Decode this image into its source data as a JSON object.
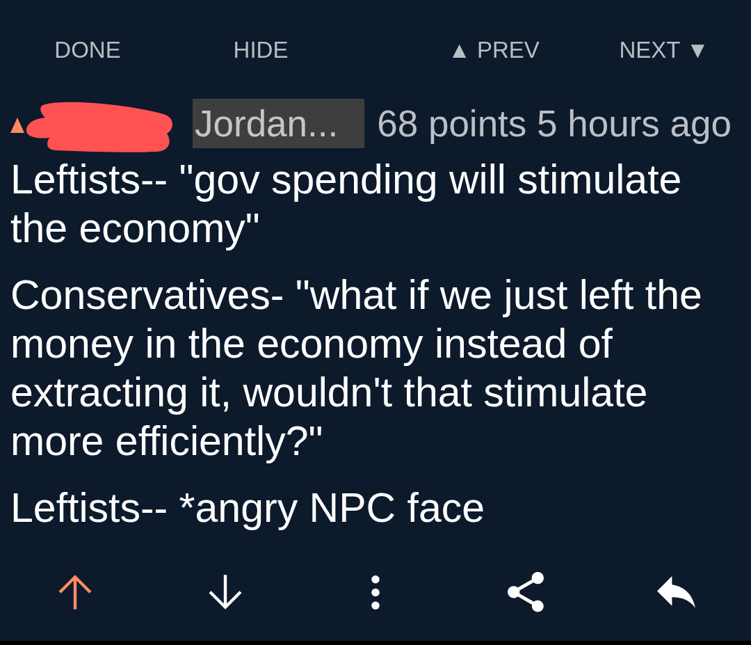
{
  "top_bar": {
    "buttons": [
      {
        "label": "DONE"
      },
      {
        "label": "HIDE"
      },
      {
        "label": "▲ PREV"
      },
      {
        "label": "NEXT ▼"
      }
    ]
  },
  "comment": {
    "upvoted": true,
    "downvoted": false,
    "author_redacted": true,
    "flair": "Jordan...",
    "meta": "68 points 5 hours ago",
    "paragraphs": [
      "Leftists-- \"gov spending will stimulate the economy\"",
      "Conservatives- \"what if we just left the money in the economy instead of extracting it, wouldn't that stimulate more efficiently?\"",
      "Leftists-- *angry NPC face"
    ]
  },
  "actions": [
    {
      "kind": "upvote"
    },
    {
      "kind": "downvote"
    },
    {
      "kind": "more"
    },
    {
      "kind": "share"
    },
    {
      "kind": "reply"
    }
  ]
}
